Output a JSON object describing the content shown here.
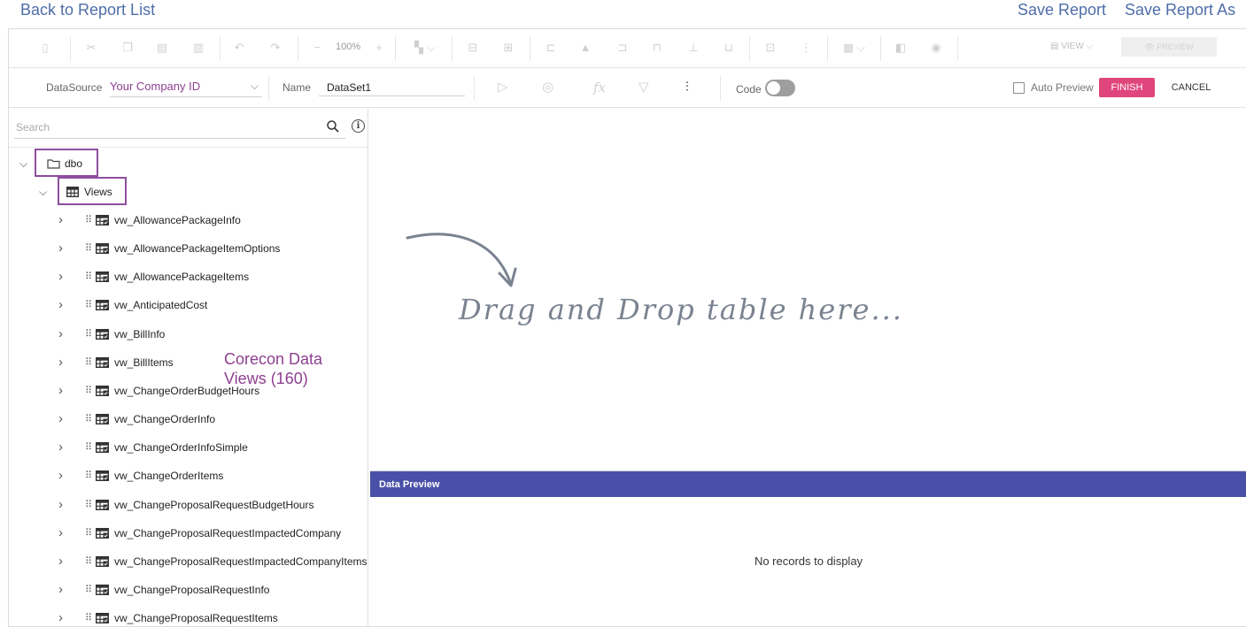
{
  "top_links": {
    "back": "Back to Report List",
    "save": "Save Report",
    "save_as": "Save Report As"
  },
  "toolbar": {
    "zoom": "100%",
    "view": "VIEW ⌵",
    "preview": "PREVIEW"
  },
  "dataset": {
    "datasource_label": "DataSource",
    "datasource_value": "Your Company ID",
    "name_label": "Name",
    "name_value": "DataSet1",
    "code_label": "Code",
    "auto_preview_label": "Auto Preview",
    "finish": "FINISH",
    "cancel": "CANCEL"
  },
  "search": {
    "placeholder": "Search"
  },
  "tree": {
    "schema": "dbo",
    "folder": "Views",
    "items": [
      "vw_AllowancePackageInfo",
      "vw_AllowancePackageItemOptions",
      "vw_AllowancePackageItems",
      "vw_AnticipatedCost",
      "vw_BillInfo",
      "vw_BillItems",
      "vw_ChangeOrderBudgetHours",
      "vw_ChangeOrderInfo",
      "vw_ChangeOrderInfoSimple",
      "vw_ChangeOrderItems",
      "vw_ChangeProposalRequestBudgetHours",
      "vw_ChangeProposalRequestImpactedCompany",
      "vw_ChangeProposalRequestImpactedCompanyItems",
      "vw_ChangeProposalRequestInfo",
      "vw_ChangeProposalRequestItems"
    ]
  },
  "annotation": {
    "line1": "Corecon Data",
    "line2": "Views (160)"
  },
  "canvas": {
    "drop_hint": "Drag and Drop table here..."
  },
  "data_preview": {
    "title": "Data Preview",
    "empty": "No records to display"
  },
  "colors": {
    "link": "#4f6ea8",
    "accent_purple": "#8e3f91",
    "finish_pink": "#e0457b",
    "preview_bar": "#4a50a8"
  }
}
